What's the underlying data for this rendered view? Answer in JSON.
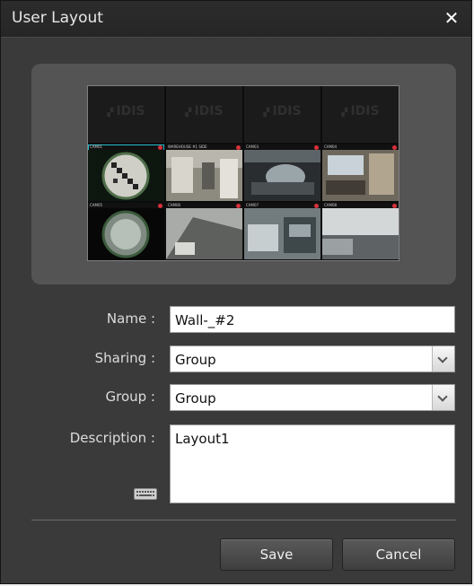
{
  "window": {
    "title": "User Layout",
    "close_label": "✕"
  },
  "preview": {
    "logo_text": "IDIS",
    "cells": [
      {
        "label": "CAM01"
      },
      {
        "label": "WAREHOUSE #1 SIDE"
      },
      {
        "label": "CAM03"
      },
      {
        "label": "CAM04"
      },
      {
        "label": "CAM05"
      },
      {
        "label": "CAM06"
      },
      {
        "label": "CAM07"
      },
      {
        "label": "CAM08"
      }
    ]
  },
  "form": {
    "name_label": "Name :",
    "name_value": "Wall-_#2",
    "sharing_label": "Sharing :",
    "sharing_value": "Group",
    "group_label": "Group :",
    "group_value": "Group",
    "description_label": "Description :",
    "description_value": "Layout1"
  },
  "buttons": {
    "save": "Save",
    "cancel": "Cancel"
  }
}
